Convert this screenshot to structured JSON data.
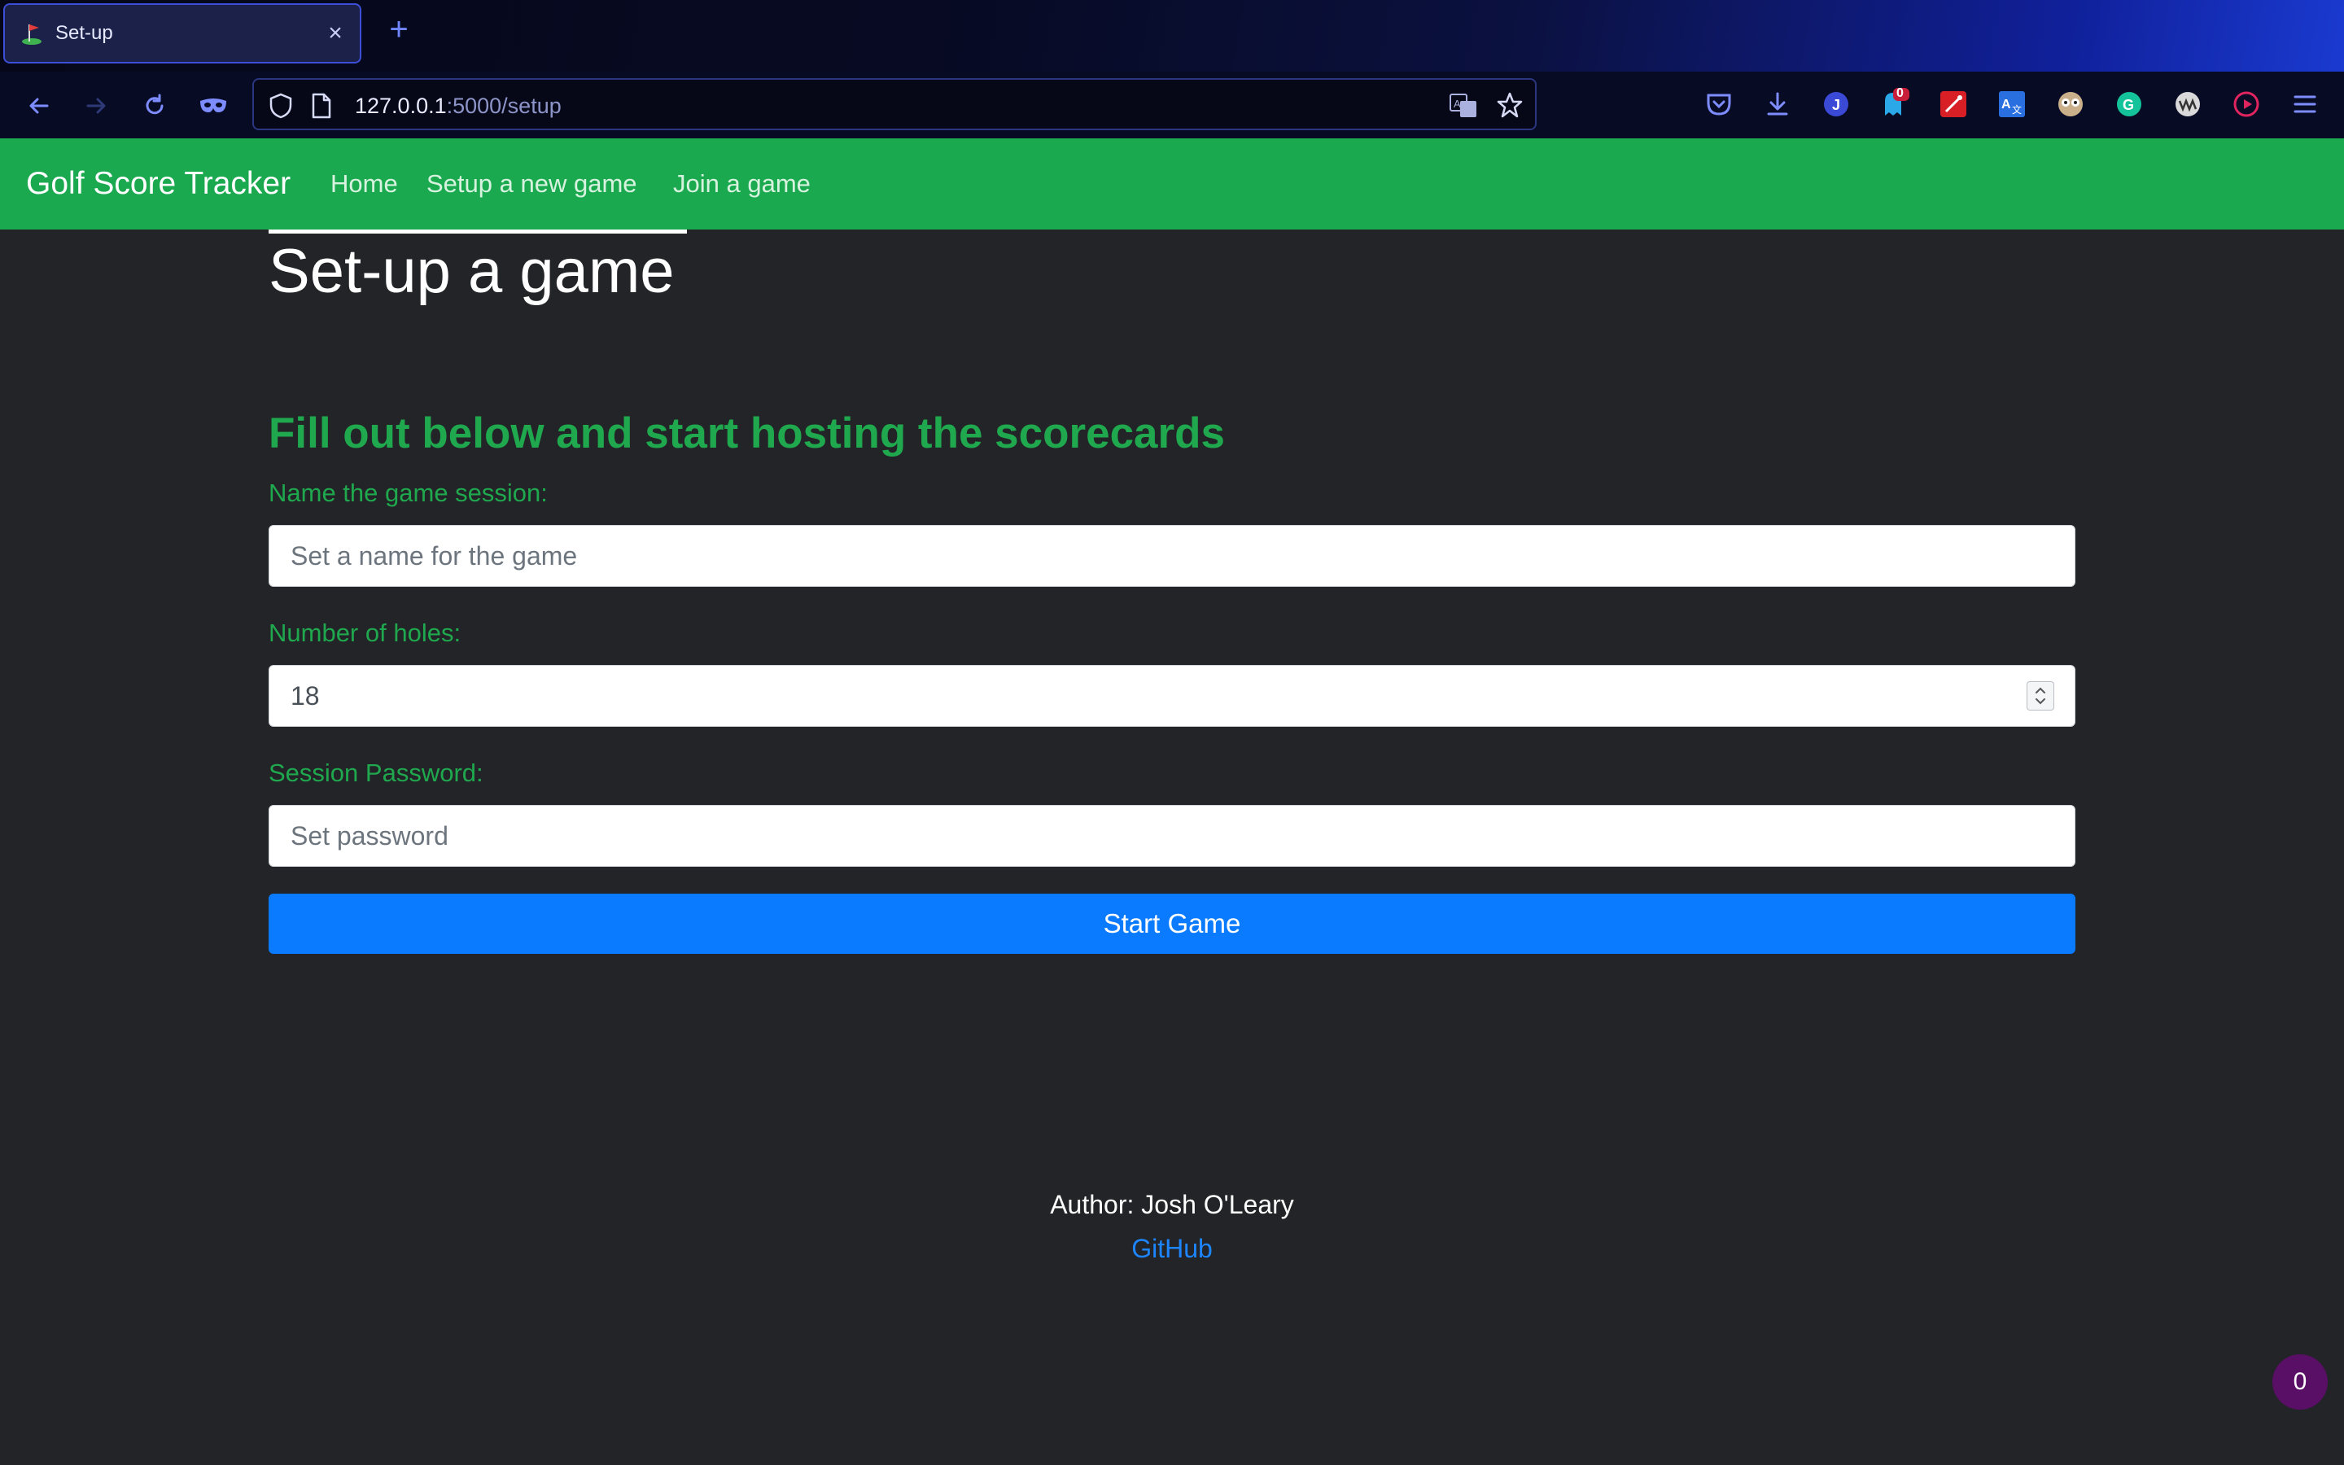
{
  "browser": {
    "tab_title": "Set-up",
    "close_glyph": "×",
    "new_tab_glyph": "+",
    "url_host": "127.0.0.1",
    "url_path": ":5000/setup",
    "extension_badge_count": "0"
  },
  "site": {
    "brand": "Golf Score Tracker",
    "nav": [
      {
        "label": "Home"
      },
      {
        "label": "Setup a new game"
      },
      {
        "label": "Join a game"
      }
    ]
  },
  "main": {
    "title": "Set-up a game",
    "subtitle": "Fill out below and start hosting the scorecards",
    "session_name": {
      "label": "Name the game session:",
      "placeholder": "Set a name for the game"
    },
    "holes": {
      "label": "Number of holes:",
      "value": "18"
    },
    "password": {
      "label": "Session Password:",
      "placeholder": "Set password"
    },
    "start_button": "Start Game"
  },
  "footer": {
    "author": "Author: Josh O'Leary",
    "github": "GitHub"
  },
  "floating_badge": "0",
  "colors": {
    "nav_green": "#1aa94f",
    "accent_green": "#1fa84d",
    "primary_blue": "#0a7bff",
    "background": "#222427"
  }
}
